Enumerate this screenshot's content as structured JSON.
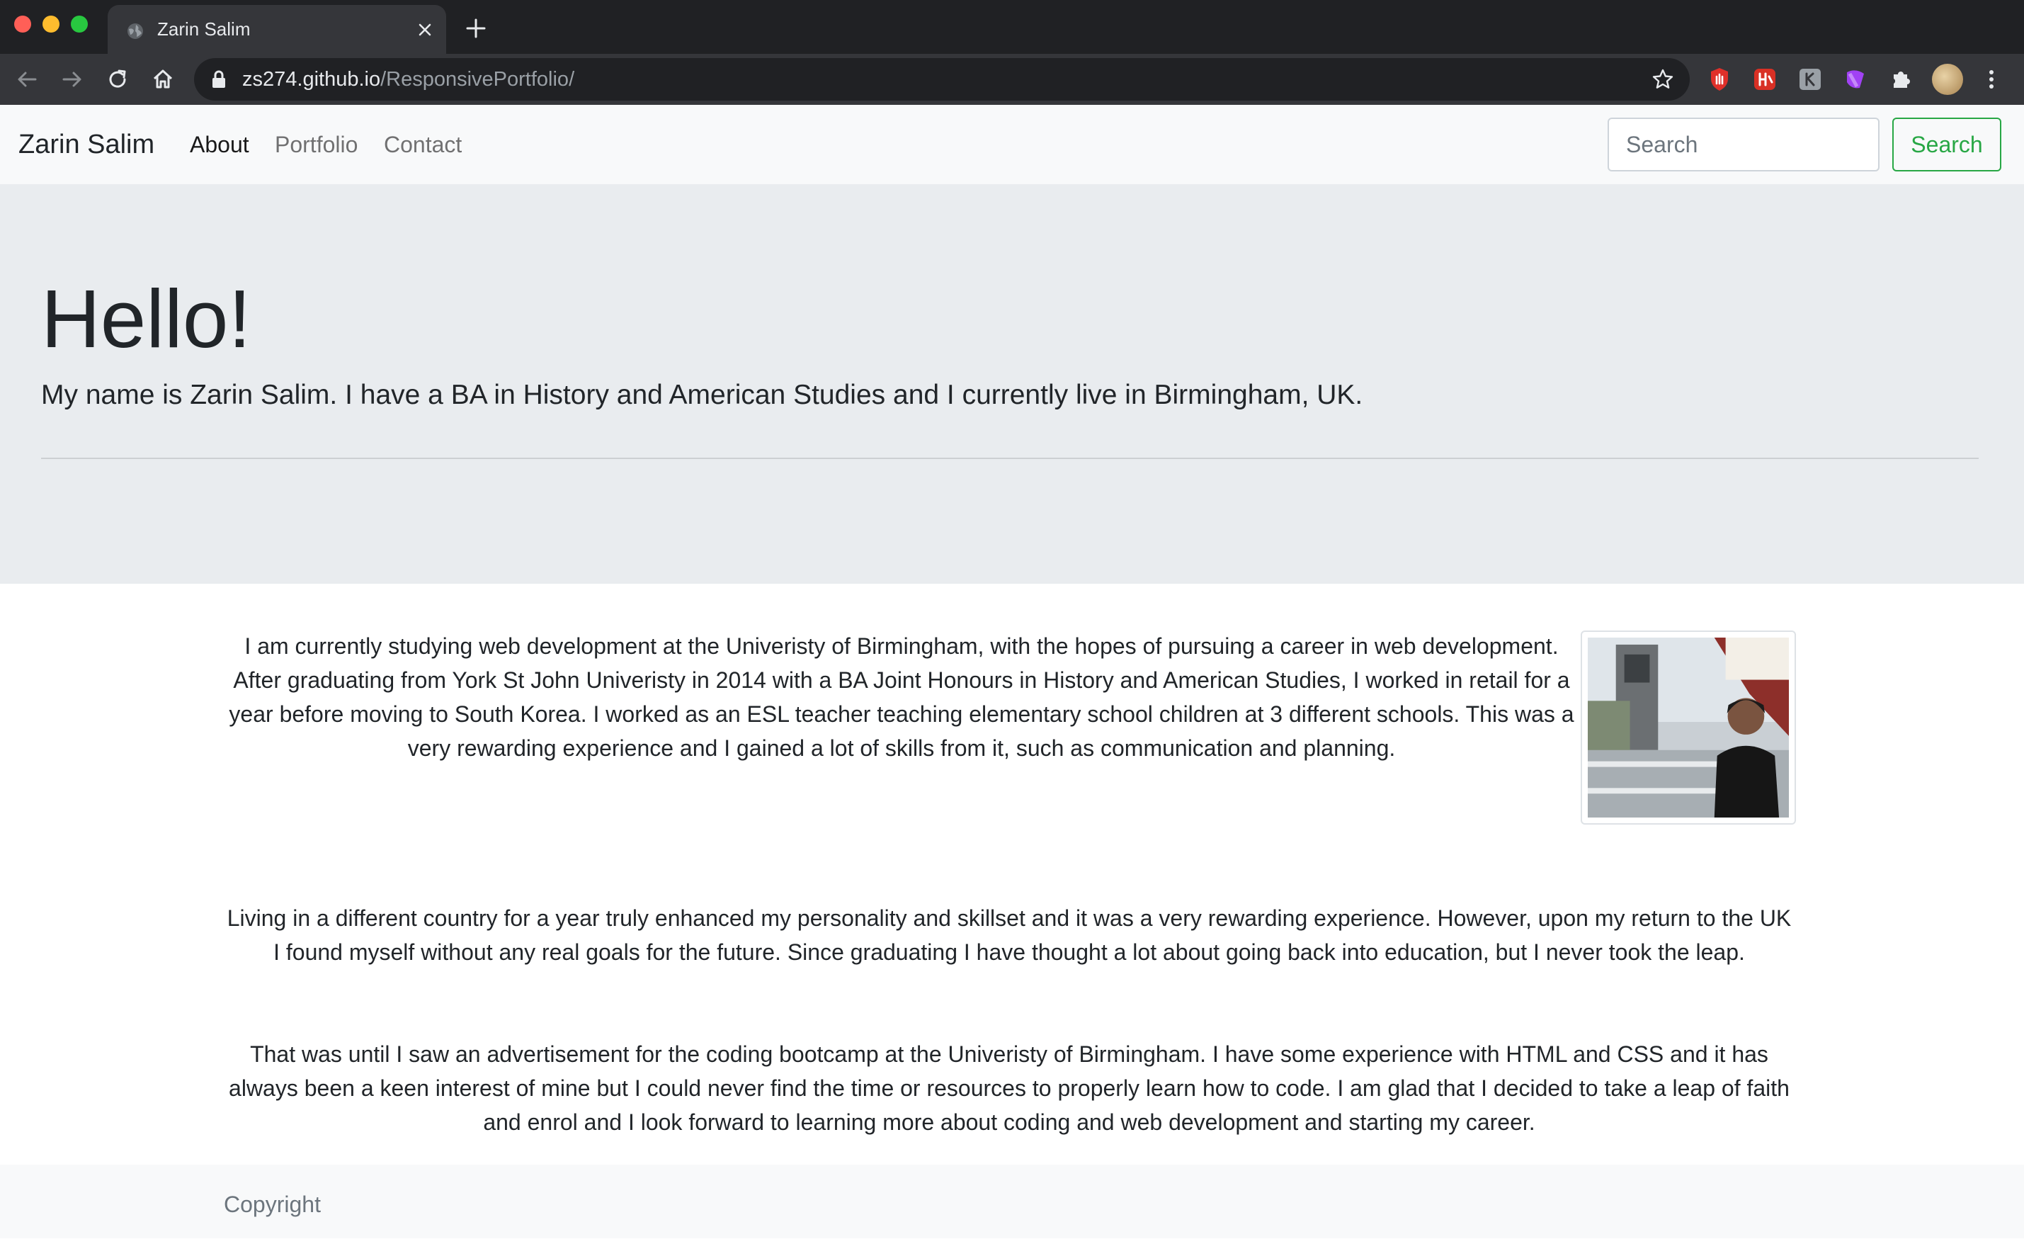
{
  "browser": {
    "tab_title": "Zarin Salim",
    "url_host": "zs274.github.io",
    "url_path": "/ResponsivePortfolio/"
  },
  "navbar": {
    "brand": "Zarin Salim",
    "links": [
      "About",
      "Portfolio",
      "Contact"
    ],
    "active_link": "About",
    "search_placeholder": "Search",
    "search_button": "Search"
  },
  "hero": {
    "title": "Hello!",
    "lead": "My name is Zarin Salim. I have a BA in History and American Studies and I currently live in Birmingham, UK."
  },
  "about": {
    "paragraphs": [
      "I am currently studying web development at the Univeristy of Birmingham, with the hopes of pursuing a career in web development. After graduating from York St John Univeristy in 2014 with a BA Joint Honours in History and American Studies, I worked in retail for a year before moving to South Korea. I worked as an ESL teacher teaching elementary school children at 3 different schools. This was a very rewarding experience and I gained a lot of skills from it, such as communication and planning.",
      "Living in a different country for a year truly enhanced my personality and skillset and it was a very rewarding experience. However, upon my return to the UK I found myself without any real goals for the future. Since graduating I have thought a lot about going back into education, but I never took the leap.",
      "That was until I saw an advertisement for the coding bootcamp at the Univeristy of Birmingham. I have some experience with HTML and CSS and it has always been a keen interest of mine but I could never find the time or resources to properly learn how to code. I am glad that I decided to take a leap of faith and enrol and I look forward to learning more about coding and web development and starting my career."
    ]
  },
  "footer": {
    "text": "Copyright"
  },
  "colors": {
    "chrome_dark": "#202124",
    "chrome_toolbar": "#35363a",
    "navbar_bg": "#f8f9fa",
    "jumbotron_bg": "#e9ecef",
    "success_green": "#28a745"
  },
  "icons": [
    "globe-favicon-icon",
    "close-icon",
    "plus-icon",
    "back-arrow-icon",
    "forward-arrow-icon",
    "reload-icon",
    "home-icon",
    "lock-icon",
    "star-icon",
    "extension-icons",
    "puzzle-icon",
    "profile-avatar",
    "kebab-menu-icon"
  ]
}
